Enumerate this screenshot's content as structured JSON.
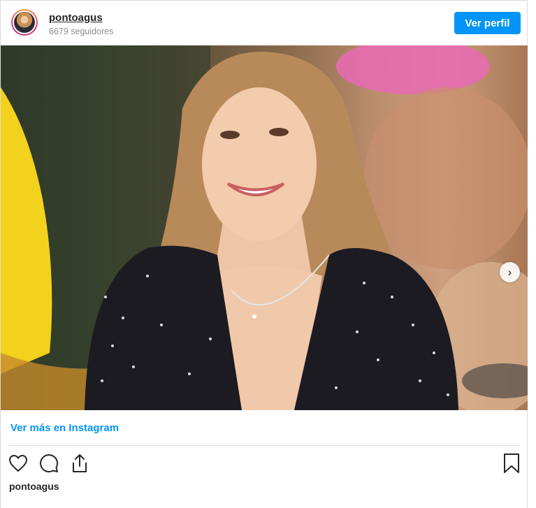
{
  "header": {
    "username": "pontoagus",
    "followers": "6679 seguidores",
    "profile_button": "Ver perfil"
  },
  "post": {
    "image_description_icon": "profile-photo",
    "carousel": {
      "total": 2,
      "active": 1
    }
  },
  "footer": {
    "more_link": "Ver más en Instagram",
    "username": "pontoagus"
  },
  "icons": [
    "heart-icon",
    "comment-icon",
    "share-icon",
    "bookmark-icon",
    "chevron-right-icon"
  ],
  "colors": {
    "accent": "#0095f6",
    "muted": "#8e8e8e",
    "border": "#dbdbdb"
  }
}
